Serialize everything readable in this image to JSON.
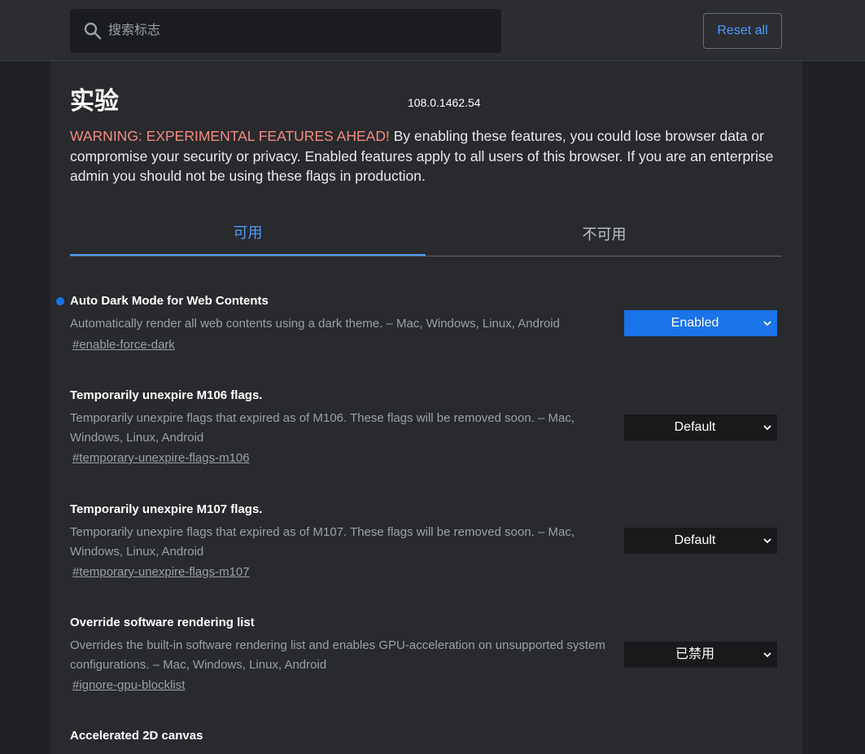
{
  "search": {
    "placeholder": "搜索标志"
  },
  "reset_button": {
    "label": "Reset all"
  },
  "header": {
    "title": "实验",
    "version": "108.0.1462.54"
  },
  "warning": {
    "label": "WARNING: EXPERIMENTAL FEATURES AHEAD!",
    "text": " By enabling these features, you could lose browser data or compromise your security or privacy. Enabled features apply to all users of this browser. If you are an enterprise admin you should not be using these flags in production."
  },
  "tabs": [
    {
      "label": "可用",
      "active": true
    },
    {
      "label": "不可用",
      "active": false
    }
  ],
  "flags": [
    {
      "title": "Auto Dark Mode for Web Contents",
      "description": "Automatically render all web contents using a dark theme. – Mac, Windows, Linux, Android",
      "link": "#enable-force-dark",
      "value": "Enabled",
      "modified": true
    },
    {
      "title": "Temporarily unexpire M106 flags.",
      "description": "Temporarily unexpire flags that expired as of M106. These flags will be removed soon. – Mac, Windows, Linux, Android",
      "link": "#temporary-unexpire-flags-m106",
      "value": "Default",
      "modified": false
    },
    {
      "title": "Temporarily unexpire M107 flags.",
      "description": "Temporarily unexpire flags that expired as of M107. These flags will be removed soon. – Mac, Windows, Linux, Android",
      "link": "#temporary-unexpire-flags-m107",
      "value": "Default",
      "modified": false
    },
    {
      "title": "Override software rendering list",
      "description": "Overrides the built-in software rendering list and enables GPU-acceleration on unsupported system configurations. – Mac, Windows, Linux, Android",
      "link": "#ignore-gpu-blocklist",
      "value": "已禁用",
      "modified": false
    },
    {
      "title": "Accelerated 2D canvas",
      "description": "",
      "link": "",
      "value": "",
      "modified": false
    }
  ],
  "colors": {
    "accent": "#4d9bff",
    "enabled_select": "#1a73e8",
    "warning": "#f28b82",
    "background": "#202124",
    "panel": "#292a2d"
  }
}
